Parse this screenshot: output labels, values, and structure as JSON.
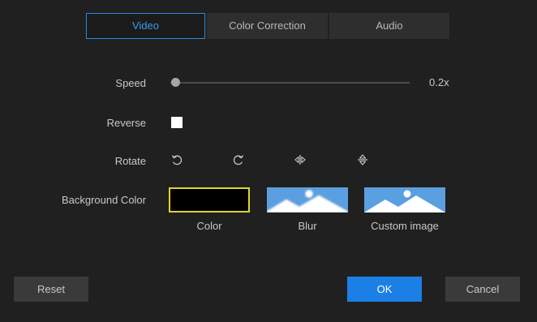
{
  "tabs": [
    {
      "label": "Video",
      "active": true
    },
    {
      "label": "Color Correction",
      "active": false
    },
    {
      "label": "Audio",
      "active": false
    }
  ],
  "speed": {
    "label": "Speed",
    "value_text": "0.2x",
    "level": 0.0
  },
  "reverse": {
    "label": "Reverse",
    "checked": false
  },
  "rotate": {
    "label": "Rotate",
    "buttons": [
      {
        "icon": "rotate-counterclockwise-icon"
      },
      {
        "icon": "rotate-clockwise-icon"
      },
      {
        "icon": "flip-horizontal-icon"
      },
      {
        "icon": "flip-vertical-icon"
      }
    ]
  },
  "background": {
    "label": "Background Color",
    "options": [
      {
        "caption": "Color",
        "selected": true,
        "swatch": "#000000"
      },
      {
        "caption": "Blur",
        "selected": false
      },
      {
        "caption": "Custom image",
        "selected": false
      }
    ],
    "selection_color": "#e3d42b",
    "image_sky_color": "#5aa0e0"
  },
  "buttons": {
    "reset_label": "Reset",
    "ok_label": "OK",
    "cancel_label": "Cancel"
  },
  "colors": {
    "accent": "#1b7fe6",
    "tab_active_text": "#3a9cf1",
    "background": "#202020"
  }
}
